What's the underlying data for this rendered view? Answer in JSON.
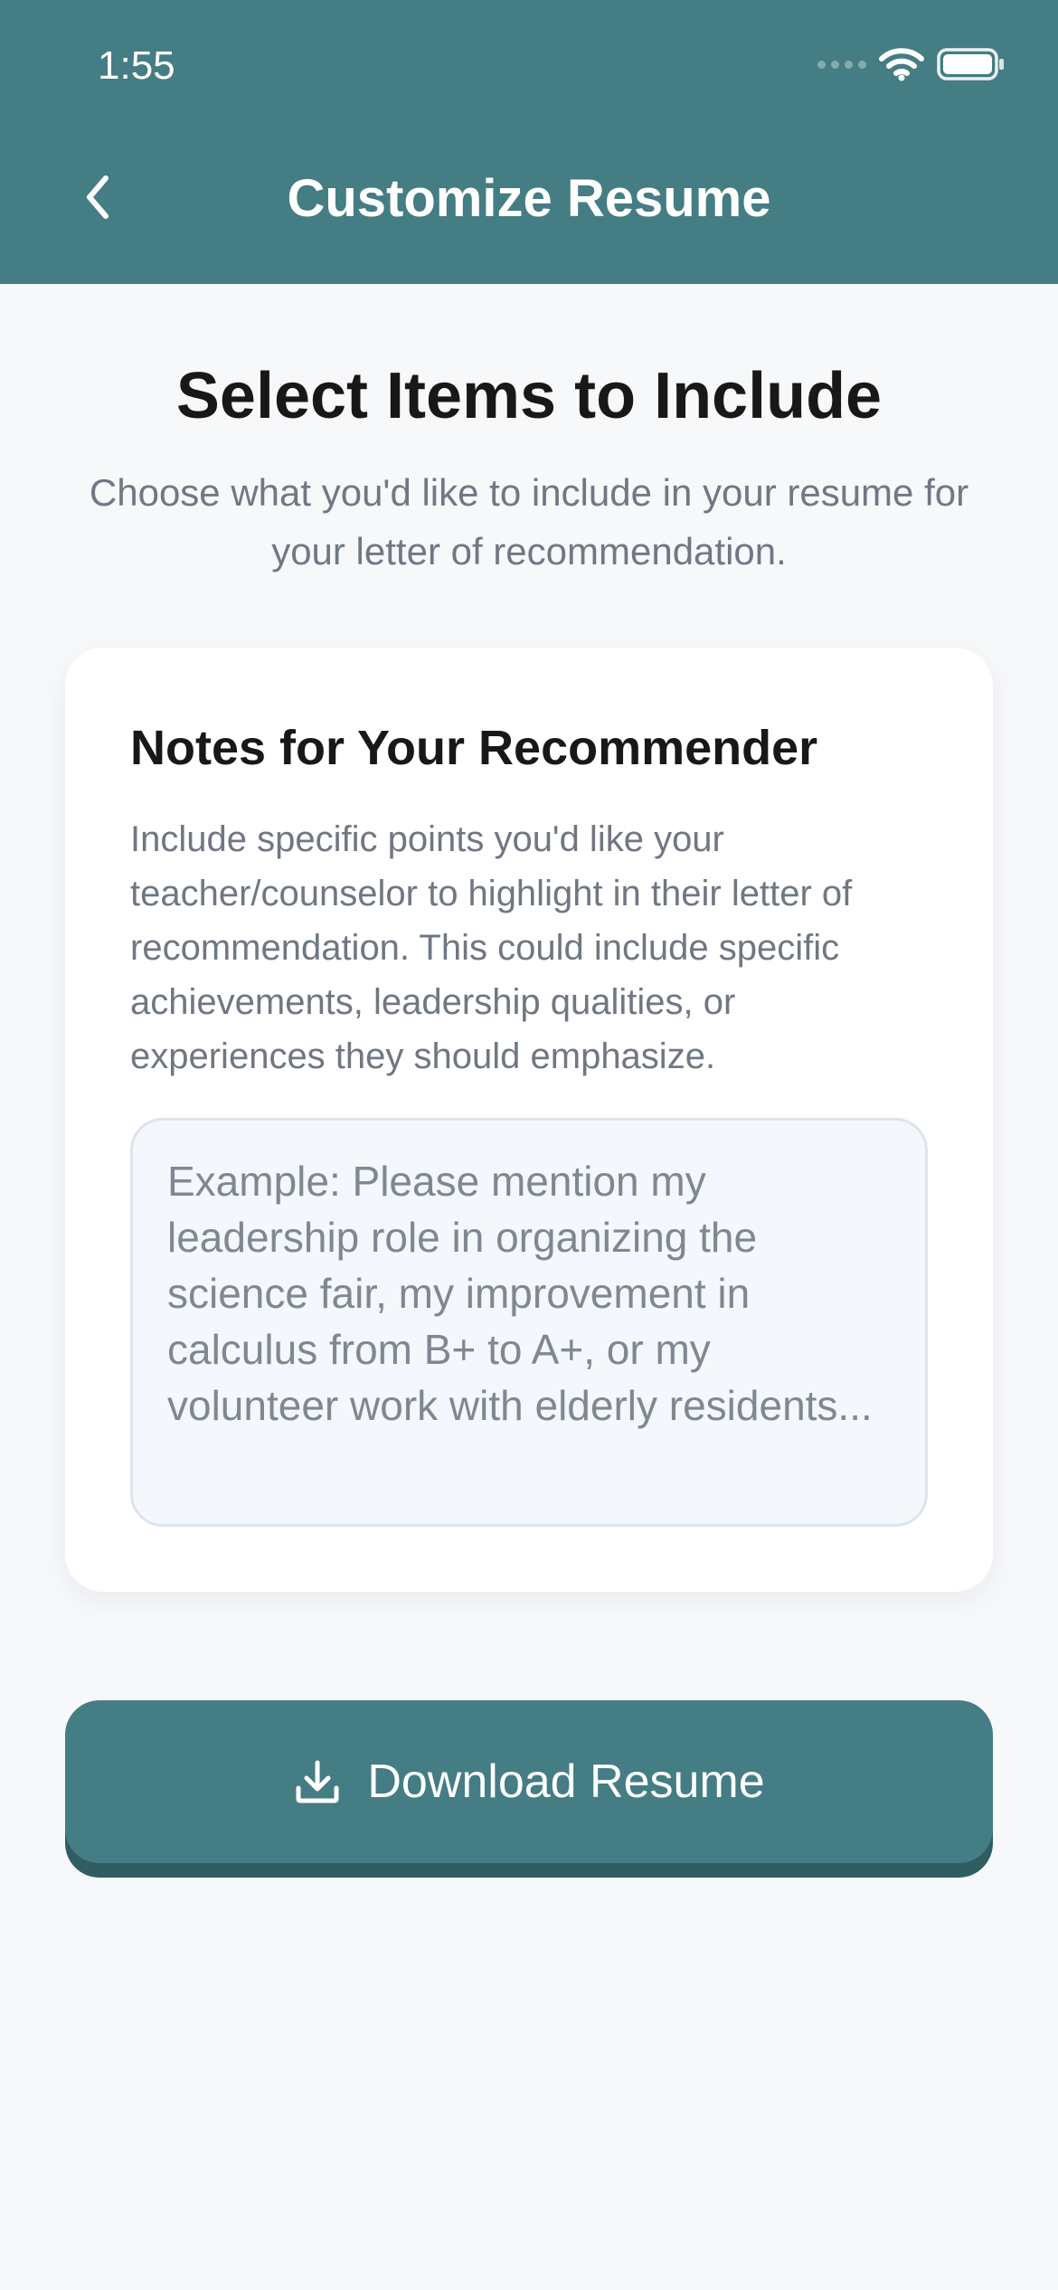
{
  "status_bar": {
    "time": "1:55",
    "icons": [
      "signal-dots-icon",
      "wifi-icon",
      "battery-icon"
    ]
  },
  "header": {
    "title": "Customize Resume",
    "back_icon": "chevron-left-icon"
  },
  "main": {
    "heading": "Select Items to Include",
    "subheading": "Choose what you'd like to include in your resume for your letter of recommendation."
  },
  "notes_card": {
    "title": "Notes for Your Recommender",
    "description": "Include specific points you'd like your teacher/counselor to highlight in their letter of recommendation. This could include specific achievements, leadership qualities, or experiences they should emphasize.",
    "input_value": "",
    "input_placeholder": "Example: Please mention my leadership role in organizing the science fair, my improvement in calculus from B+ to A+, or my volunteer work with elderly residents..."
  },
  "actions": {
    "download_label": "Download Resume",
    "download_icon": "download-icon"
  },
  "colors": {
    "brand": "#447d83",
    "brand_dark": "#2f5d62",
    "background": "#f6f8fa",
    "heading_text": "#181818",
    "muted_text": "#707883"
  }
}
